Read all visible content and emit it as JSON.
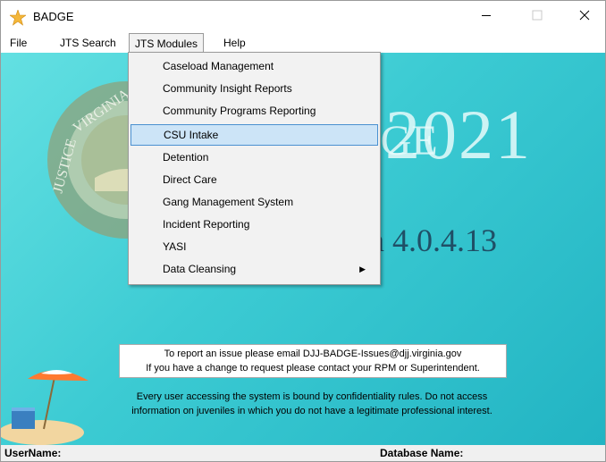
{
  "window": {
    "title": "BADGE",
    "icon": "star-badge-icon"
  },
  "menubar": {
    "file": "File",
    "jts_search": "JTS Search",
    "jts_modules": "JTS Modules",
    "help": "Help"
  },
  "dropdown": {
    "items": [
      {
        "label": "Caseload Management",
        "highlighted": false
      },
      {
        "label": "Community Insight Reports",
        "highlighted": false
      },
      {
        "label": "Community Programs Reporting",
        "highlighted": false
      },
      {
        "label": "CSU Intake",
        "highlighted": true
      },
      {
        "label": "Detention",
        "highlighted": false
      },
      {
        "label": "Direct Care",
        "highlighted": false
      },
      {
        "label": "Gang Management System",
        "highlighted": false
      },
      {
        "label": "Incident Reporting",
        "highlighted": false
      },
      {
        "label": "YASI",
        "highlighted": false
      },
      {
        "label": "Data Cleansing",
        "highlighted": false,
        "has_submenu": true
      }
    ]
  },
  "main": {
    "badge_text": "DGE",
    "year": "2021",
    "version": "on 4.0.4.13",
    "seal_text_top": "VIRGINIA",
    "seal_text_left": "JUSTICE",
    "notice_line1": "To report an issue please email DJJ-BADGE-Issues@djj.virginia.gov",
    "notice_line2": "If you have a change to request please contact your RPM or Superintendent.",
    "confidential_line1": "Every user accessing the system is bound by confidentiality rules. Do not access",
    "confidential_line2": "information on juveniles in which you do not have a legitimate professional interest."
  },
  "statusbar": {
    "username_label": "UserName:",
    "database_label": "Database Name:"
  },
  "colors": {
    "background_start": "#63e0e2",
    "background_end": "#22b4c3",
    "highlight": "#cce4f7",
    "highlight_border": "#4a90d0"
  }
}
